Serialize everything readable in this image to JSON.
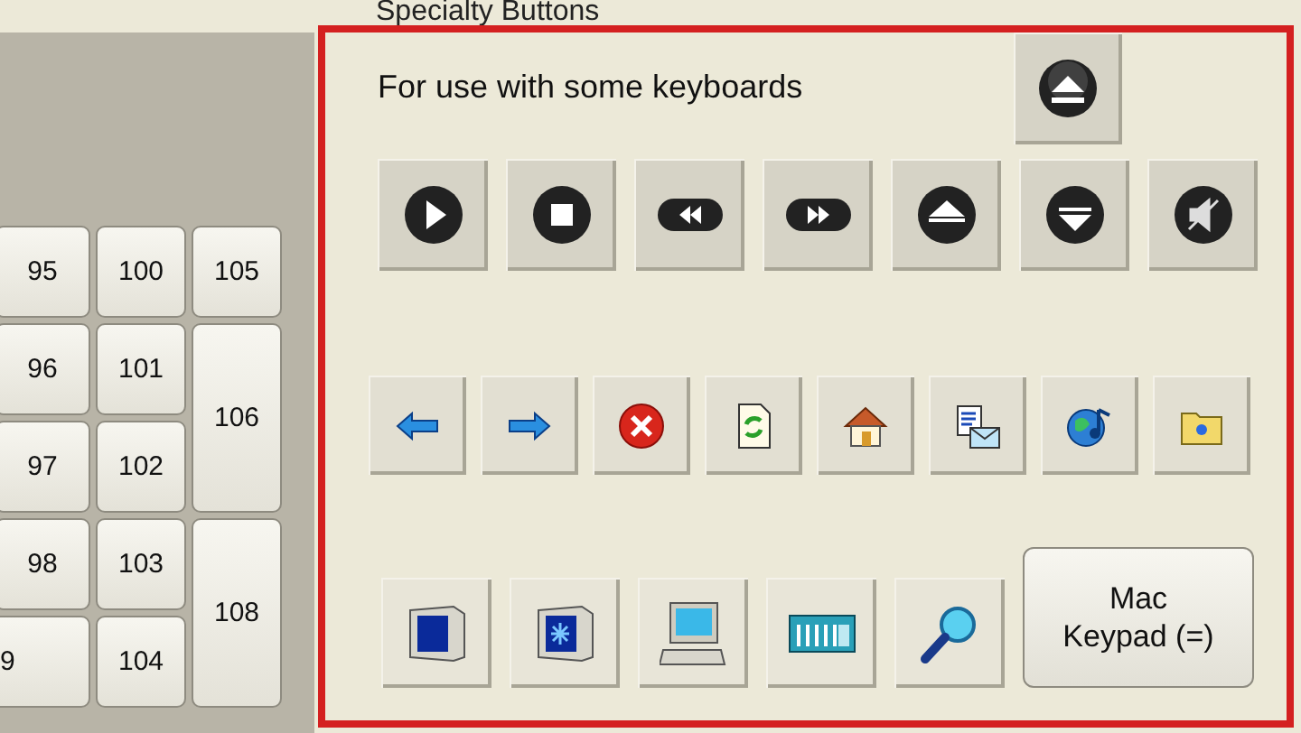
{
  "keypad": {
    "columns": [
      [
        {
          "label": "95",
          "tall": false
        },
        {
          "label": "96",
          "tall": false
        },
        {
          "label": "97",
          "tall": false
        },
        {
          "label": "98",
          "tall": false
        },
        {
          "label": "9",
          "tall": false
        }
      ],
      [
        {
          "label": "100",
          "tall": false
        },
        {
          "label": "101",
          "tall": false
        },
        {
          "label": "102",
          "tall": false
        },
        {
          "label": "103",
          "tall": false
        },
        {
          "label": "104",
          "tall": false
        }
      ],
      [
        {
          "label": "105",
          "tall": false
        },
        {
          "label": "106",
          "tall": true
        },
        {
          "label": "108",
          "tall": true
        }
      ]
    ]
  },
  "specialty": {
    "title": "Specialty Buttons",
    "note": "For use with some keyboards",
    "mac_keypad": "Mac Keypad (=)"
  }
}
